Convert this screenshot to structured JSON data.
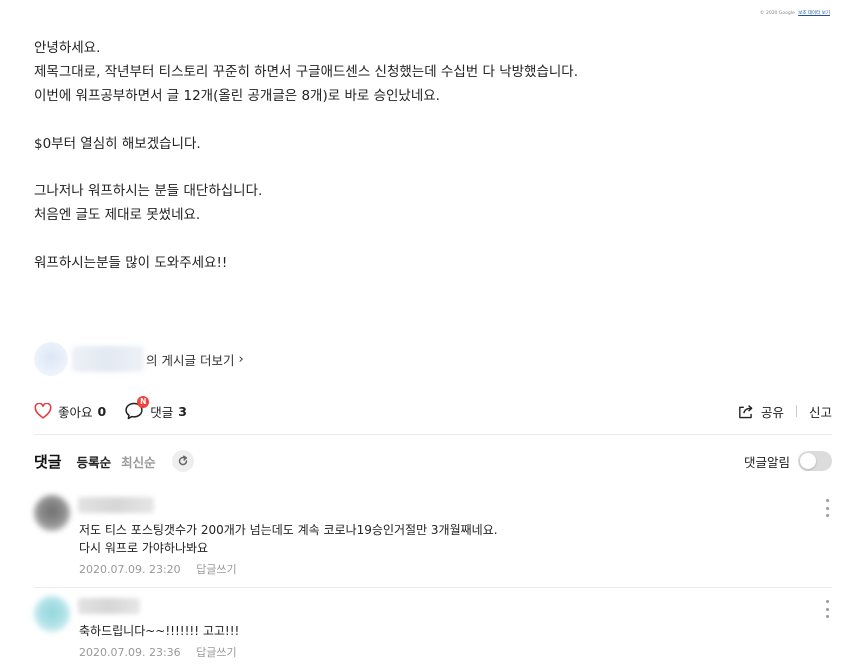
{
  "footer_copyright": {
    "text": "© 2020 Google",
    "link": "보조 데이터 보기"
  },
  "post": {
    "lines": [
      "안녕하세요.",
      "제목그대로, 작년부터 티스토리 꾸준히 하면서 구글애드센스 신청했는데 수십번 다 낙방했습니다.",
      "이번에 워프공부하면서 글 12개(올린 공개글은 8개)로 바로 승인났네요.",
      "",
      "$0부터 열심히 해보겠습니다.",
      "",
      "그나저나 워프하시는 분들 대단하십니다.",
      "처음엔 글도 제대로 못썼네요.",
      "",
      "워프하시는분들 많이 도와주세요!!"
    ]
  },
  "author_link": {
    "label": "의 게시글 더보기",
    "chevron": "›"
  },
  "actions": {
    "like_label": "좋아요",
    "like_count": "0",
    "comment_label": "댓글",
    "comment_count": "3",
    "new_badge": "N",
    "share_label": "공유",
    "report_label": "신고",
    "heart_color": "#e8383d",
    "badge_color": "#f0433a"
  },
  "comments_section": {
    "title": "댓글",
    "sort_registered": "등록순",
    "sort_latest": "최신순",
    "notify_label": "댓글알림",
    "notify_on": false
  },
  "comments": [
    {
      "lines": [
        "저도 티스 포스팅갯수가 200개가 넘는데도 계속 코로나19승인거절만 3개월째네요.",
        "다시 워프로 가야하나봐요"
      ],
      "date": "2020.07.09. 23:20",
      "reply_label": "답글쓰기"
    },
    {
      "lines": [
        "축하드립니다~~!!!!!!! 고고!!!"
      ],
      "date": "2020.07.09. 23:36",
      "reply_label": "답글쓰기"
    }
  ]
}
